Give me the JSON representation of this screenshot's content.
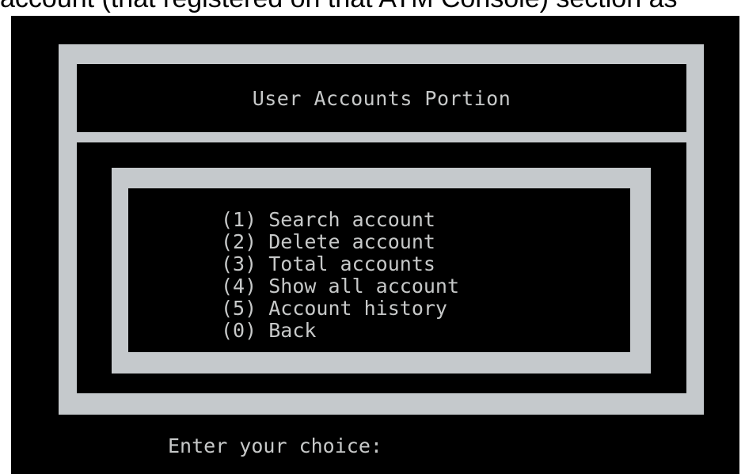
{
  "caption": "account (that registered on that ATM Console) section as",
  "title": "User Accounts Portion",
  "menu": [
    {
      "key": "(1)",
      "label": "Search account"
    },
    {
      "key": "(2)",
      "label": "Delete account"
    },
    {
      "key": "(3)",
      "label": "Total accounts"
    },
    {
      "key": "(4)",
      "label": "Show all account"
    },
    {
      "key": "(5)",
      "label": "Account history"
    },
    {
      "key": "(0)",
      "label": "Back"
    }
  ],
  "prompt": "Enter your choice:",
  "colors": {
    "frame": "#c5c9cc",
    "background": "#000000",
    "text": "#c7c9c9"
  }
}
